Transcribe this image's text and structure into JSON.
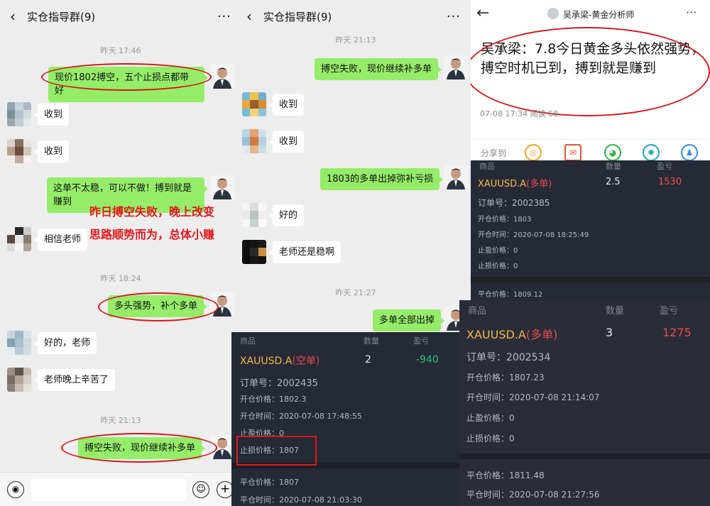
{
  "left_chat": {
    "title": "实仓指导群(9)",
    "back_icon": "‹",
    "more_icon": "···",
    "times": [
      "昨天 17:46",
      "昨天 18:24",
      "昨天 21:13"
    ],
    "messages": [
      {
        "side": "me",
        "text": "现价1802搏空，五个止损点都带好"
      },
      {
        "side": "other",
        "text": "收到"
      },
      {
        "side": "other",
        "text": "收到"
      },
      {
        "side": "me",
        "text": "这单不太稳，可以不做！搏到就是赚到"
      },
      {
        "side": "other",
        "text": "相信老师"
      },
      {
        "side": "me",
        "text": "多头强势，补个多单"
      },
      {
        "side": "other",
        "text": "好的，老师"
      },
      {
        "side": "other",
        "text": "老师晚上辛苦了"
      },
      {
        "side": "me",
        "text": "搏空失败，现价继续补多单"
      }
    ],
    "overlay_lines": [
      "昨日搏空失败，晚上改变",
      "思路顺势而为，总体小赚"
    ]
  },
  "mid_chat": {
    "title": "实仓指导群(9)",
    "back_icon": "‹",
    "more_icon": "···",
    "times": [
      "昨天 21:13",
      "昨天 21:27"
    ],
    "messages": [
      {
        "side": "me",
        "text": "搏空失败，现价继续补多单"
      },
      {
        "side": "other",
        "text": "收到"
      },
      {
        "side": "other",
        "text": "收到"
      },
      {
        "side": "me",
        "text": "1803的多单出掉弥补亏损"
      },
      {
        "side": "other",
        "text": "好的"
      },
      {
        "side": "other",
        "text": "老师还是稳啊"
      },
      {
        "side": "me",
        "text": "多单全部出掉"
      }
    ]
  },
  "trade_short": {
    "headers": [
      "商品",
      "数量",
      "盈亏"
    ],
    "symbol": "XAUUSD.A",
    "direction": "(空单)",
    "quantity": "2",
    "pnl": "-940",
    "order_no": "订单号：2002435",
    "open_price": "开仓价格：1802.3",
    "open_time": "开仓时间：2020-07-08 17:48:55",
    "take_profit": "止盈价格：0",
    "stop_loss": "止损价格：1807",
    "close_price": "平仓价格：1807",
    "close_time": "平仓时间：2020-07-08 21:03:30",
    "colors": {
      "symbol": "#f2b84a",
      "pnl": "#2fc27a",
      "direction": "#e14d4d"
    }
  },
  "article": {
    "back_icon": "←",
    "author": "吴承梁-黄金分析师",
    "more_icon": "···",
    "title": "吴承梁：7.8今日黄金多头依然强势，搏空时机已到，搏到就是赚到",
    "meta": "07-08 17:34  阅读 68",
    "share_label": "分享到",
    "share_icons": [
      "weibo-icon",
      "mail-icon",
      "wechat-icon",
      "moments-icon",
      "qq-icon"
    ]
  },
  "trade_long1": {
    "headers": [
      "商品",
      "数量",
      "盈亏"
    ],
    "symbol": "XAUUSD.A",
    "direction": "(多单)",
    "quantity": "2.5",
    "pnl": "1530",
    "order_no": "订单号：2002385",
    "open_price": "开仓价格：1803",
    "open_time": "开仓时间：2020-07-08 18:25:49",
    "take_profit": "止盈价格：0",
    "stop_loss": "止损价格：0",
    "close_price": "平仓价格：1809.12"
  },
  "trade_long2": {
    "headers": [
      "商品",
      "数量",
      "盈亏"
    ],
    "symbol": "XAUUSD.A",
    "direction": "(多单)",
    "quantity": "3",
    "pnl": "1275",
    "order_no": "订单号：2002534",
    "open_price": "开仓价格：1807.23",
    "open_time": "开仓时间：2020-07-08 21:14:07",
    "take_profit": "止盈价格：0",
    "stop_loss": "止损价格：0",
    "close_price": "平仓价格：1811.48",
    "close_time": "平仓时间：2020-07-08 21:27:56"
  }
}
